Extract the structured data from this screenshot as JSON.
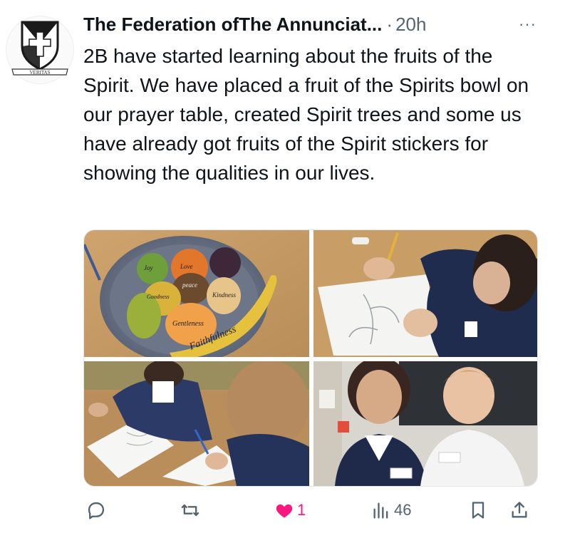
{
  "tweet": {
    "author": "The Federation ofThe Annunciat...",
    "separator": "·",
    "time": "20h",
    "more_icon": "more-horizontal-icon",
    "text": "2B have started learning about the fruits of the Spirit. We have placed a fruit of the Spirits bowl on our prayer table, created Spirit trees and some us have already got fruits of the Spirit stickers for showing the qualities in our lives.",
    "avatar": {
      "motto": "VERITAS",
      "icon": "dominican-shield-logo"
    }
  },
  "media": {
    "fruit_labels": [
      "Joy",
      "Love",
      "peace",
      "Goodness",
      "Kindness",
      "Gentleness",
      "Faithfulness"
    ],
    "photos": [
      {
        "name": "fruit-bowl-photo"
      },
      {
        "name": "child-drawing-photo"
      },
      {
        "name": "children-drawing-table-photo"
      },
      {
        "name": "two-children-smiling-photo"
      }
    ]
  },
  "actions": {
    "reply_icon": "reply-icon",
    "retweet_icon": "retweet-icon",
    "like_icon": "heart-filled-icon",
    "like_count": "1",
    "views_icon": "views-icon",
    "views_count": "46",
    "bookmark_icon": "bookmark-icon",
    "share_icon": "share-icon"
  },
  "colors": {
    "like": "#f91880",
    "secondary": "#536471",
    "text": "#0f1419"
  }
}
